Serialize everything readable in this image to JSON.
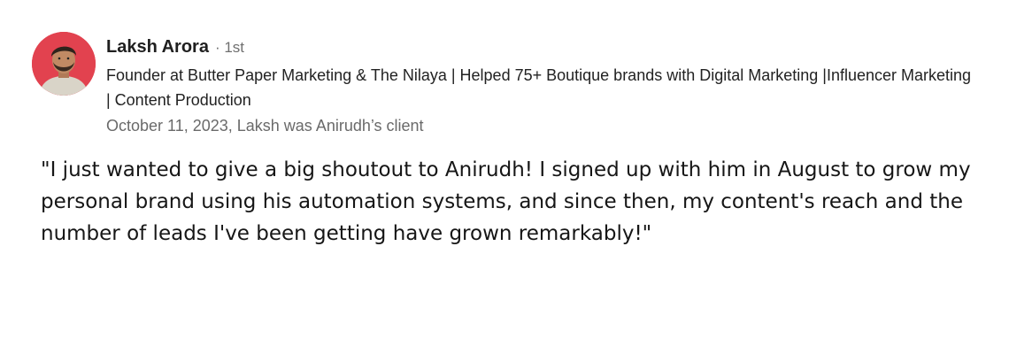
{
  "recommendation": {
    "author": {
      "name": "Laksh Arora",
      "connection_degree": "· 1st",
      "headline": "Founder at Butter Paper Marketing & The Nilaya | Helped 75+ Boutique brands with Digital Marketing |Influencer Marketing | Content Production",
      "avatar_icon": "person-avatar-icon"
    },
    "meta": "October 11, 2023, Laksh was Anirudh’s client",
    "quote": "\"I just wanted to give a big shoutout to Anirudh! I signed up with him in August to grow my personal brand using his automation systems, and since then, my content's reach and the number of leads I've been getting have grown remarkably!\""
  },
  "colors": {
    "avatar_bg": "#e2424f",
    "name": "#1f1f1f",
    "meta": "#6a6a6a"
  }
}
